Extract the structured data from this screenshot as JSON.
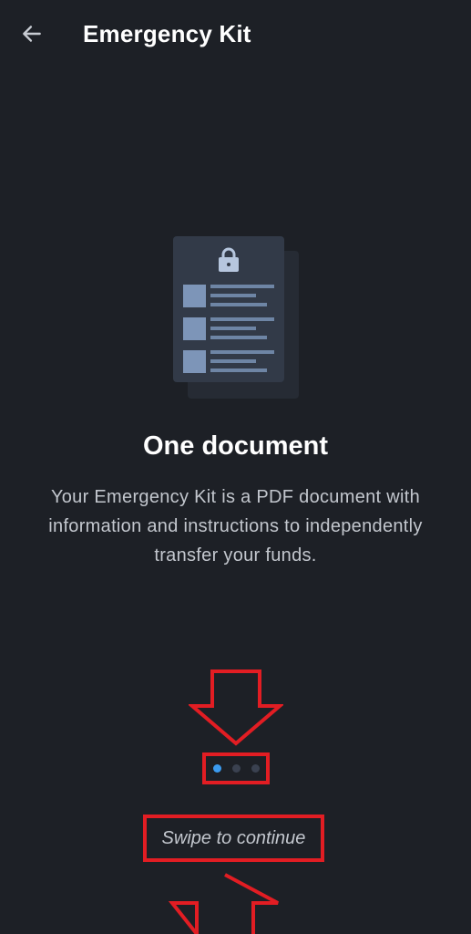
{
  "header": {
    "title": "Emergency Kit",
    "back_icon": "arrow-left-icon"
  },
  "illustration": {
    "icon": "pdf-document-lock-icon"
  },
  "slide": {
    "title": "One document",
    "body": "Your Emergency Kit is a PDF document with information and instructions to independently transfer your funds."
  },
  "pager": {
    "total": 3,
    "current": 1
  },
  "hint": {
    "swipe_label": "Swipe to continue"
  },
  "colors": {
    "background": "#1d2026",
    "accent": "#3b9bf0",
    "annotation": "#e21d23"
  }
}
